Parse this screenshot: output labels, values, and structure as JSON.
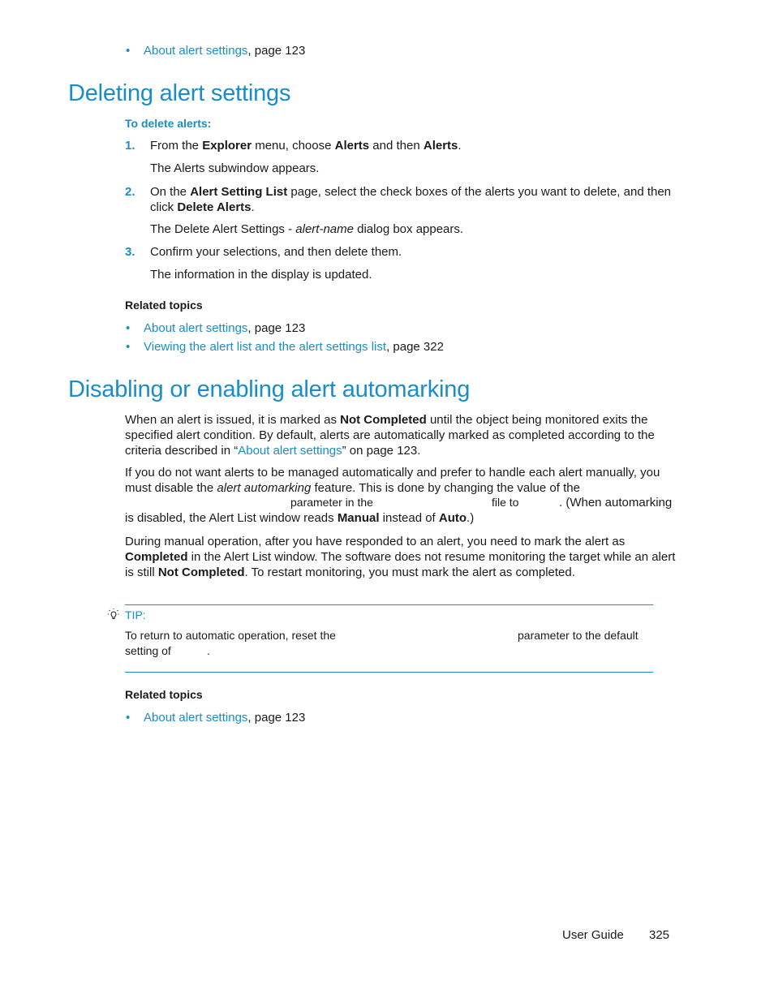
{
  "top_related": {
    "items": [
      {
        "link": "About alert settings",
        "suffix": ", page 123"
      }
    ]
  },
  "section1": {
    "title": "Deleting alert settings",
    "procedure_label": "To delete alerts:",
    "steps": [
      {
        "num": "1.",
        "p1": "From the ",
        "b1": "Explorer",
        "p2": " menu, choose ",
        "b2": "Alerts",
        "p3": " and then ",
        "b3": "Alerts",
        "p4": ".",
        "result": "The Alerts subwindow appears."
      },
      {
        "num": "2.",
        "p1": "On the ",
        "b1": "Alert Setting List",
        "p2": " page, select the check boxes of the alerts you want to delete, and then click ",
        "b2": "Delete Alerts",
        "p3": ".",
        "result_p1": "The Delete Alert Settings - ",
        "result_i": "alert-name",
        "result_p2": " dialog box appears."
      },
      {
        "num": "3.",
        "text": "Confirm your selections, and then delete them.",
        "result": "The information in the display is updated."
      }
    ],
    "related_title": "Related topics",
    "related": [
      {
        "link": "About alert settings",
        "suffix": ", page 123"
      },
      {
        "link": "Viewing the alert list and the alert settings list",
        "suffix": ", page 322"
      }
    ]
  },
  "section2": {
    "title": "Disabling or enabling alert automarking",
    "para1": {
      "p1": "When an alert is issued, it is marked as ",
      "b1": "Not Completed",
      "p2": " until the object being monitored exits the specified alert condition. By default, alerts are automatically marked as completed according to the criteria described in “",
      "link": "About alert settings",
      "p3": "” on page 123."
    },
    "para2": {
      "p1": "If you do not want alerts to be managed automatically and prefer to handle each alert manually, you must disable the ",
      "i1": "alert automarking",
      "p2": " feature. This is done by changing the value of the",
      "p3": "parameter in the",
      "p4": "file to",
      "p5": ". (When automarking",
      "p6": "is disabled, the Alert List window reads ",
      "b1": "Manual",
      "p7": " instead of ",
      "b2": "Auto",
      "p8": ".)"
    },
    "para3": {
      "p1": "During manual operation, after you have responded to an alert, you need to mark the alert as ",
      "b1": "Completed",
      "p2": " in the Alert List window. The software does not resume monitoring the target while an alert is still ",
      "b2": "Not Completed",
      "p3": ". To restart monitoring, you must mark the alert as completed."
    },
    "tip": {
      "icon": "lightbulb-icon",
      "label": "TIP:",
      "line1_a": "To return to automatic operation, reset the",
      "line1_b": "parameter to the default",
      "line2_a": "setting of",
      "line2_b": "."
    },
    "related_title": "Related topics",
    "related": [
      {
        "link": "About alert settings",
        "suffix": ", page 123"
      }
    ]
  },
  "footer": {
    "guide": "User Guide",
    "page": "325"
  },
  "colors": {
    "accent": "#1a8cc7",
    "text": "#1a1a1a"
  }
}
